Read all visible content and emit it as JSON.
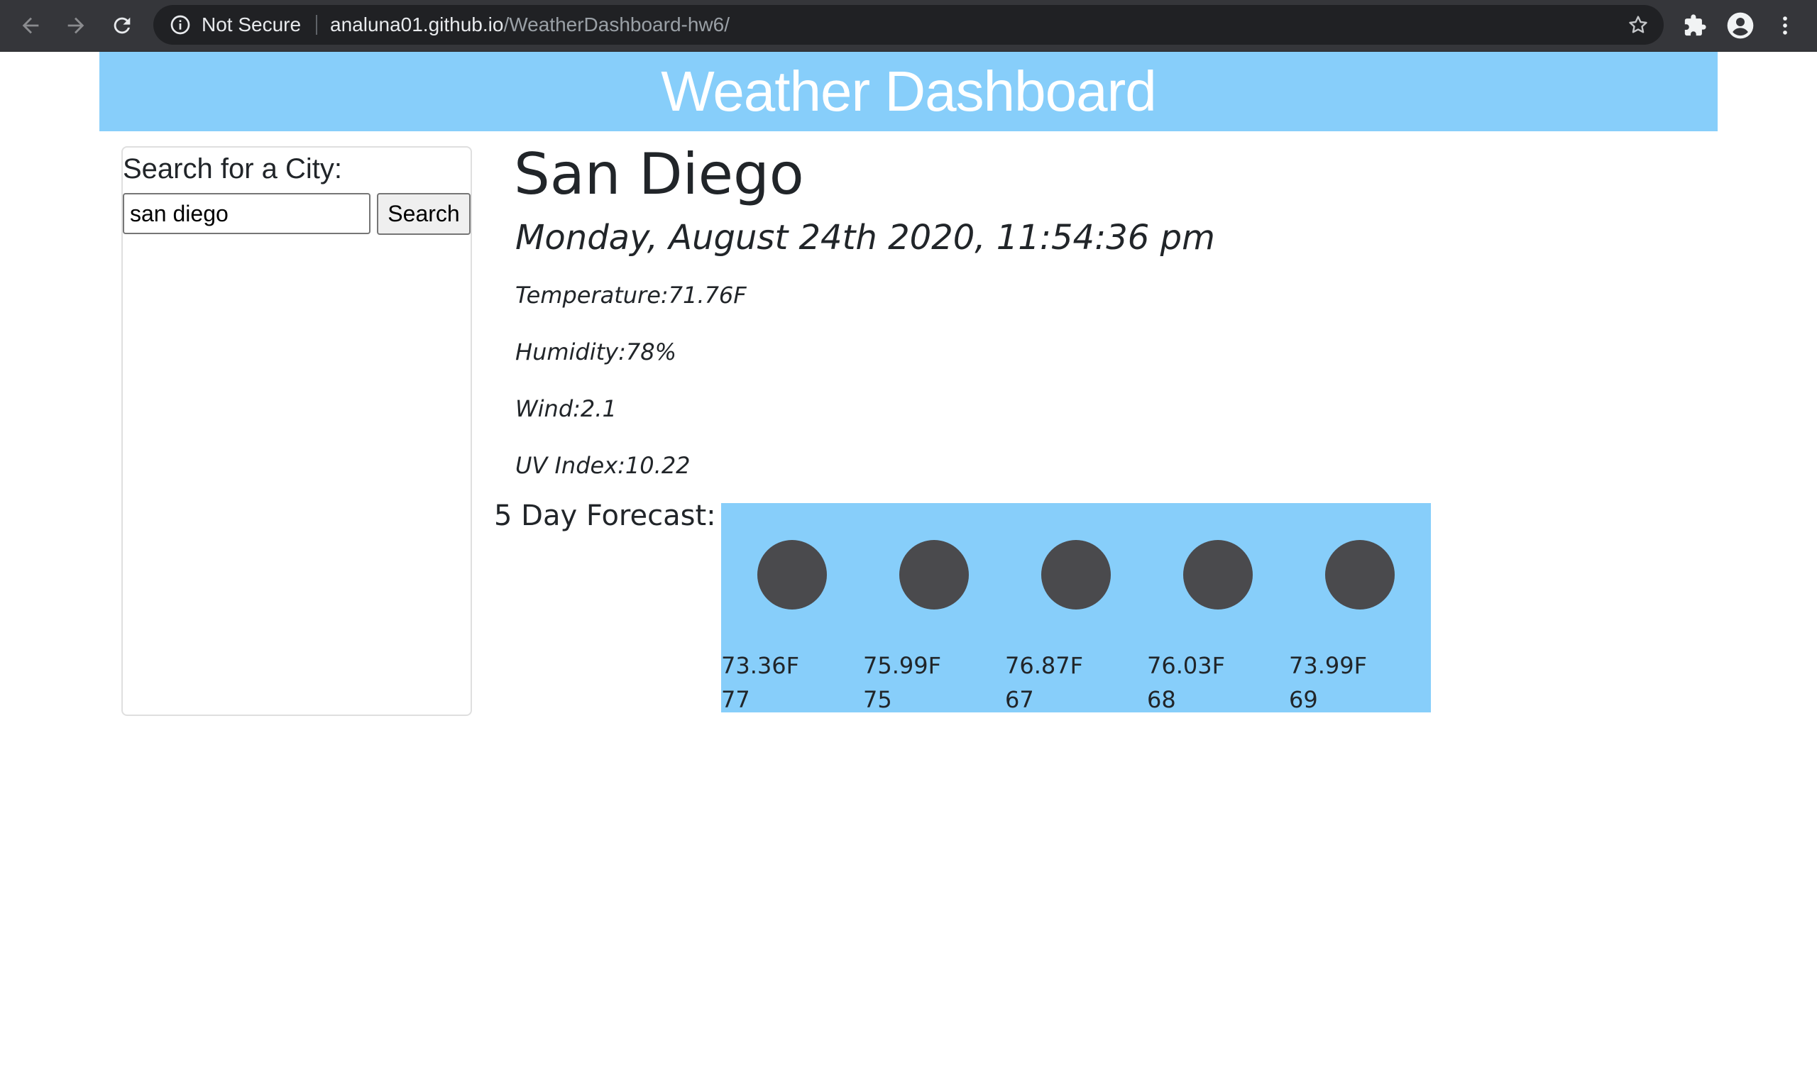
{
  "browser": {
    "security_label": "Not Secure",
    "url_host": "analuna01.github.io",
    "url_path": "/WeatherDashboard-hw6/",
    "icons": [
      "back-icon",
      "forward-icon",
      "reload-icon",
      "info-icon",
      "star-icon",
      "extensions-icon",
      "profile-icon",
      "menu-icon"
    ]
  },
  "header": {
    "title": "Weather Dashboard",
    "background": "#87cefa"
  },
  "sidebar": {
    "label": "Search for a City:",
    "search_value": "san diego",
    "search_button": "Search"
  },
  "current": {
    "city": "San Diego",
    "datetime": "Monday, August 24th 2020, 11:54:36 pm",
    "stats": [
      {
        "text": "Temperature:71.76F"
      },
      {
        "text": "Humidity:78%"
      },
      {
        "text": "Wind:2.1"
      },
      {
        "text": "UV Index:10.22"
      }
    ]
  },
  "forecast": {
    "label": "5 Day Forecast:",
    "days": [
      {
        "temp": "73.36F",
        "humidity": "77",
        "icon": "weather-icon"
      },
      {
        "temp": "75.99F",
        "humidity": "75",
        "icon": "weather-icon"
      },
      {
        "temp": "76.87F",
        "humidity": "67",
        "icon": "weather-icon"
      },
      {
        "temp": "76.03F",
        "humidity": "68",
        "icon": "weather-icon"
      },
      {
        "temp": "73.99F",
        "humidity": "69",
        "icon": "weather-icon"
      }
    ]
  }
}
